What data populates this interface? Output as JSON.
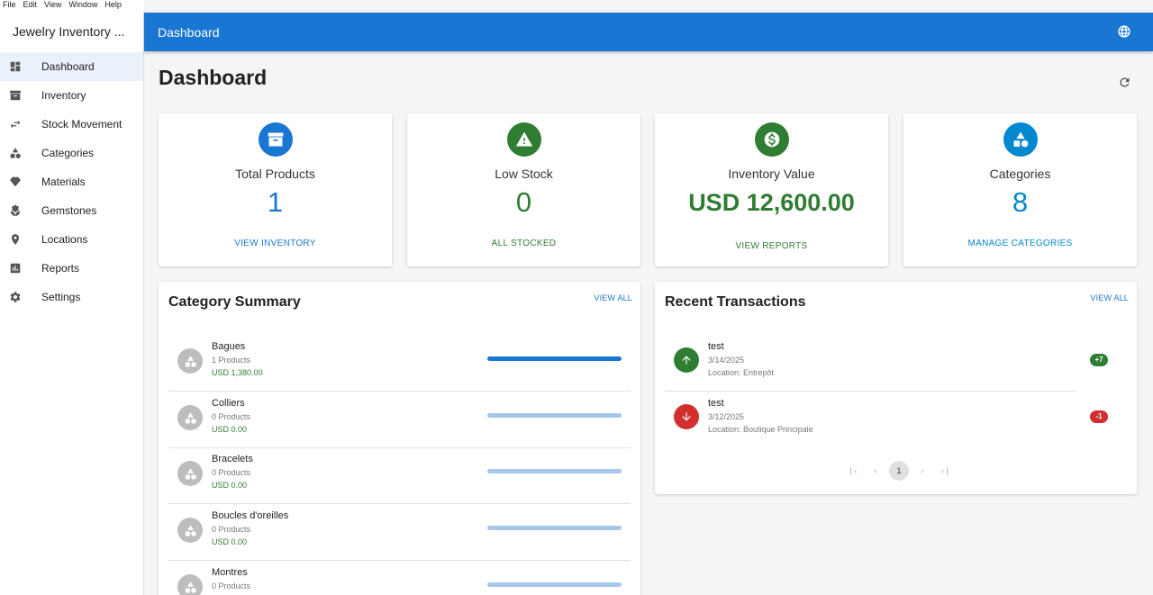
{
  "menubar": {
    "items": [
      "File",
      "Edit",
      "View",
      "Window",
      "Help"
    ]
  },
  "app": {
    "title": "Jewelry Inventory ..."
  },
  "sidebar": {
    "items": [
      {
        "label": "Dashboard",
        "icon": "dashboard-icon",
        "active": true
      },
      {
        "label": "Inventory",
        "icon": "inventory-box-icon"
      },
      {
        "label": "Stock Movement",
        "icon": "swap-arrows-icon"
      },
      {
        "label": "Categories",
        "icon": "shapes-icon"
      },
      {
        "label": "Materials",
        "icon": "diamond-icon"
      },
      {
        "label": "Gemstones",
        "icon": "gem-spa-icon"
      },
      {
        "label": "Locations",
        "icon": "location-pin-icon"
      },
      {
        "label": "Reports",
        "icon": "bar-chart-icon"
      },
      {
        "label": "Settings",
        "icon": "gear-icon"
      }
    ]
  },
  "appbar": {
    "title": "Dashboard",
    "icon": "globe-icon"
  },
  "page": {
    "title": "Dashboard",
    "refresh_icon": "refresh-icon"
  },
  "stats": [
    {
      "label": "Total Products",
      "value": "1",
      "link": "VIEW INVENTORY",
      "color": "#1976d2",
      "icon": "inventory-box-icon"
    },
    {
      "label": "Low Stock",
      "value": "0",
      "link": "ALL STOCKED",
      "color": "#2e7d32",
      "icon": "warning-icon"
    },
    {
      "label": "Inventory Value",
      "value": "USD 12,600.00",
      "link": "VIEW REPORTS",
      "color": "#2e7d32",
      "icon": "dollar-icon"
    },
    {
      "label": "Categories",
      "value": "8",
      "link": "MANAGE CATEGORIES",
      "color": "#0288d1",
      "icon": "shapes-icon"
    }
  ],
  "category_summary": {
    "title": "Category Summary",
    "link": "VIEW ALL",
    "rows": [
      {
        "name": "Bagues",
        "count": "1 Products",
        "value": "USD 1,380.00",
        "share": 1.0
      },
      {
        "name": "Colliers",
        "count": "0 Products",
        "value": "USD 0.00",
        "share": 0
      },
      {
        "name": "Bracelets",
        "count": "0 Products",
        "value": "USD 0.00",
        "share": 0
      },
      {
        "name": "Boucles d'oreilles",
        "count": "0 Products",
        "value": "USD 0.00",
        "share": 0
      },
      {
        "name": "Montres",
        "count": "0 Products",
        "value": "",
        "share": 0
      }
    ]
  },
  "recent_transactions": {
    "title": "Recent Transactions",
    "link": "VIEW ALL",
    "rows": [
      {
        "name": "test",
        "date": "3/14/2025",
        "location": "Location: Entrepôt",
        "qty": "+7",
        "direction": "in",
        "color": "#2e7d32"
      },
      {
        "name": "test",
        "date": "3/12/2025",
        "location": "Location: Boutique Principale",
        "qty": "-1",
        "direction": "out",
        "color": "#d32f2f"
      }
    ],
    "pagination": {
      "current": "1"
    }
  }
}
